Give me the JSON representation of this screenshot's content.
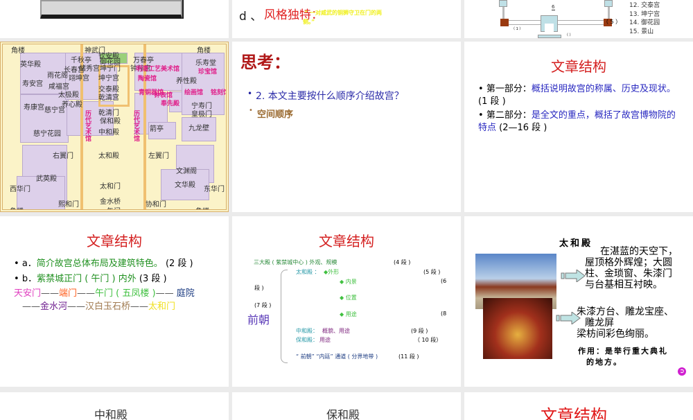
{
  "row1": {
    "slide2": {
      "prefix": "d 、",
      "heading": "风格独特：",
      "quote_line1": "“ 一对威武的铜狮守卫在门的两",
      "quote_line2": "侧。”"
    },
    "slide3": {
      "list": [
        "12. 交泰宫",
        "13. 坤宁宫",
        "14. 御花园",
        "15. 景山"
      ],
      "label5": "（ 5 ）",
      "label1": "（ 1 ）",
      "label6": "6",
      "label_blank": "（ ）"
    }
  },
  "map": {
    "labels": [
      "角楼",
      "神武门",
      "角楼",
      "钦安殿",
      "英华殿",
      "千秋亭",
      "御花园",
      "万春亭",
      "乐寿堂",
      "雨花阁",
      "长春宫",
      "储秀宫",
      "坤宁门",
      "钟粹宫",
      "寿安宫",
      "咸福宫",
      "翊坤宫",
      "坤宁宫",
      "养性殿",
      "交泰殿",
      "太极殿",
      "乾清宫",
      "养心殿",
      "寿康宫",
      "慈宁宫",
      "乾清门",
      "宁寿门",
      "保和殿",
      "皇极门",
      "箭亭",
      "九龙壁",
      "慈宁花园",
      "中和殿",
      "太和殿",
      "右翼门",
      "左翼门",
      "文渊阁",
      "武英殿",
      "太和门",
      "文华殿",
      "西华门",
      "东华门",
      "金水桥",
      "熙和门",
      "协和门",
      "角楼",
      "午门",
      "角楼"
    ],
    "red_labels": [
      "明清工艺美术馆",
      "陶瓷馆",
      "珍宝馆",
      "青铜器馆",
      "钟表馆",
      "奉先殿",
      "绘画馆",
      "铭刻馆",
      "历代艺术馆",
      "历代艺术馆"
    ]
  },
  "think": {
    "title": "思考：",
    "question": "2. 本文主要按什么顺序介绍故宫？",
    "answer": "空间顺序"
  },
  "structure1": {
    "title": "文章结构",
    "b1_label": "第一部分：",
    "b1_text": "概括说明故宫的称属、历史及现状。",
    "b1_para": "(1 段 )",
    "b2_label": "第二部分：",
    "b2_text": "是全文的重点，概括了故宫博物院的特点",
    "b2_para": "(2—16 段 )"
  },
  "structure2": {
    "title": "文章结构",
    "a_label": "a．",
    "a_text": "简介故宫总体布局及建筑特色。",
    "a_para": "(2 段 )",
    "b_label": "b．",
    "b_text": "紫禁城正门 ( 午门 ) 内外",
    "b_para": "(3 段 )",
    "route": [
      "天安门",
      "——",
      "端门",
      "——",
      "午门 ( 五凤楼 )",
      "—— ",
      "庭院"
    ],
    "route2": [
      "——",
      "金水河",
      "——",
      "汉白玉石桥",
      "——",
      "太和门"
    ],
    "route_colors": [
      "#e040c0",
      "#555555",
      "#ff6020",
      "#555555",
      "#40c040",
      "#555555",
      "#1a3a80"
    ],
    "route2_colors": [
      "#555555",
      "#702090",
      "#555555",
      "#a07a50",
      "#555555",
      "#f0e020"
    ]
  },
  "structure3": {
    "title": "文章结构",
    "line1": "三大殿 ( 紫禁城中心 ) 外观、规模",
    "p4": "(4 段 )",
    "taihe": "太和殿 ：",
    "waixing": "◆外形",
    "p5": "(5 段 )",
    "neijing": "◆ 内景",
    "p6a": "(6",
    "p6b": "段 )",
    "weizhi": "◆ 位置",
    "p7": "(7 段 )",
    "yongtu": "◆ 用途",
    "p8": "(8",
    "qianchao": "前朝",
    "zhonghe": "中和殿：",
    "zhonghe_text": "概貌、用途",
    "p9": "(9 段 )",
    "baohe": "保和殿：",
    "baohe_text": "用途",
    "p10": "（ 10 段）",
    "tongdao": "“ 前朝” “内廷” 通道 ( 分界地带 )",
    "p11": "(11 段 )"
  },
  "taihedian": {
    "title": "太和殿",
    "desc1": "在湛蓝的天空下，",
    "desc2": "屋顶格外辉煌；大圆",
    "desc3": "柱、金琐窗、朱漆门",
    "desc4": "与台基相互衬映。",
    "inner1": "朱漆方台、雕龙宝座、",
    "inner2": "雕龙屏",
    "inner3": "梁枋间彩色绚丽。",
    "use1": "作用：是举行重大典礼",
    "use2": "的地方。"
  },
  "row4": {
    "s1": "中和殿",
    "s2": "保和殿",
    "s3": "文章结构"
  }
}
